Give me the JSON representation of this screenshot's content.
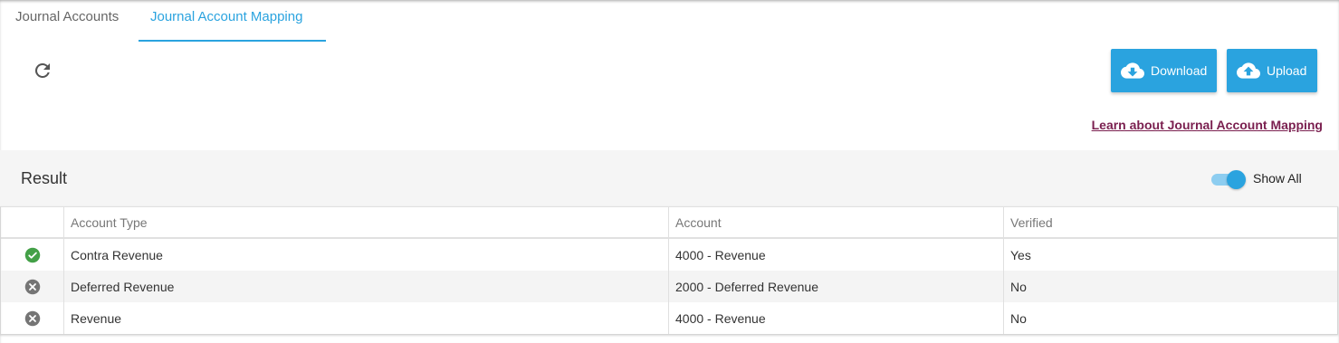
{
  "tabs": [
    {
      "label": "Journal Accounts",
      "active": false
    },
    {
      "label": "Journal Account Mapping",
      "active": true
    }
  ],
  "toolbar": {
    "refresh_icon": "refresh-icon",
    "download_label": "Download",
    "upload_label": "Upload"
  },
  "learn_link": "Learn about Journal Account Mapping",
  "result": {
    "title": "Result",
    "toggle_label": "Show All",
    "toggle_on": true
  },
  "table": {
    "columns": [
      "",
      "Account Type",
      "Account",
      "Verified"
    ],
    "rows": [
      {
        "status": "verified",
        "account_type": "Contra Revenue",
        "account": "4000 - Revenue",
        "verified": "Yes"
      },
      {
        "status": "unverified",
        "account_type": "Deferred Revenue",
        "account": "2000 - Deferred Revenue",
        "verified": "No"
      },
      {
        "status": "unverified",
        "account_type": "Revenue",
        "account": "4000 - Revenue",
        "verified": "No"
      }
    ]
  },
  "colors": {
    "accent": "#2aa3df",
    "link": "#7a1f4f",
    "success": "#43a047",
    "neutral_icon": "#757575"
  }
}
